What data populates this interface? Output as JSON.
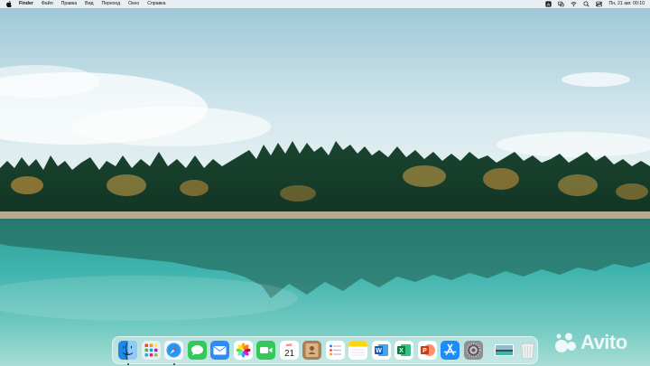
{
  "menubar": {
    "app_name": "Finder",
    "items": [
      "Файл",
      "Правка",
      "Вид",
      "Переход",
      "Окно",
      "Справка"
    ],
    "clock": "Пн, 21 авг.  00:10",
    "status_icons": [
      "text-input-icon",
      "display-mirror-icon",
      "wifi-icon",
      "search-icon",
      "control-center-icon"
    ]
  },
  "dock": {
    "apps": [
      {
        "name": "Finder",
        "icon": "finder-icon",
        "running": true
      },
      {
        "name": "Launchpad",
        "icon": "launchpad-icon",
        "running": false
      },
      {
        "name": "Safari",
        "icon": "safari-icon",
        "running": true
      },
      {
        "name": "Messages",
        "icon": "messages-icon",
        "running": false
      },
      {
        "name": "Mail",
        "icon": "mail-icon",
        "running": false
      },
      {
        "name": "Photos",
        "icon": "photos-icon",
        "running": false
      },
      {
        "name": "FaceTime",
        "icon": "facetime-icon",
        "running": false
      },
      {
        "name": "Calendar",
        "icon": "calendar-icon",
        "running": false
      },
      {
        "name": "Contacts",
        "icon": "contacts-icon",
        "running": false
      },
      {
        "name": "Reminders",
        "icon": "reminders-icon",
        "running": false
      },
      {
        "name": "Notes",
        "icon": "notes-icon",
        "running": false
      },
      {
        "name": "Word",
        "icon": "word-icon",
        "running": false
      },
      {
        "name": "Excel",
        "icon": "excel-icon",
        "running": false
      },
      {
        "name": "PowerPoint",
        "icon": "powerpoint-icon",
        "running": false
      },
      {
        "name": "App Store",
        "icon": "app-store-icon",
        "running": false
      },
      {
        "name": "System Settings",
        "icon": "system-settings-icon",
        "running": false
      }
    ],
    "calendar": {
      "month": "АВГ.",
      "day": "21"
    },
    "word_letter": "W",
    "excel_letter": "X",
    "powerpoint_letter": "P"
  },
  "watermark": {
    "text": "Avito"
  },
  "colors": {
    "sky_top": "#9cc6d6",
    "water": "#3fb3ad",
    "forest": "#1f4a35",
    "autumn": "#b98b3a"
  }
}
